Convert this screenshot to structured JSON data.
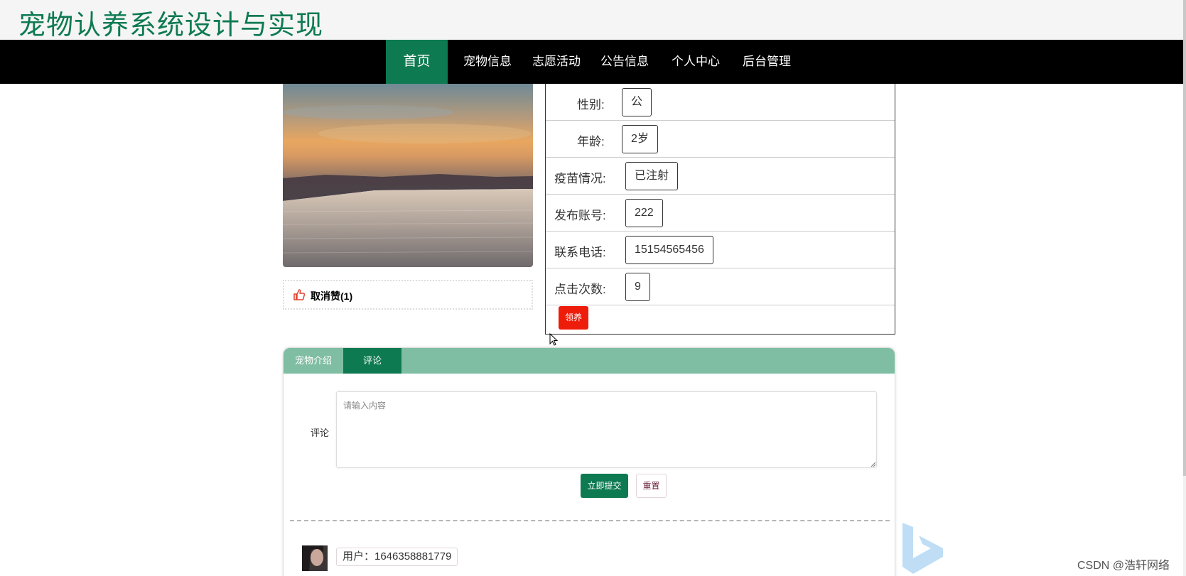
{
  "header": {
    "site_title": "宠物认养系统设计与实现"
  },
  "nav": {
    "items": [
      {
        "label": "首页",
        "active": true
      },
      {
        "label": "宠物信息"
      },
      {
        "label": "志愿活动"
      },
      {
        "label": "公告信息"
      },
      {
        "label": "个人中心"
      },
      {
        "label": "后台管理"
      }
    ]
  },
  "pet": {
    "like_label": "取消赞(1)",
    "fields": [
      {
        "label": "性别:",
        "value": "公"
      },
      {
        "label": "年龄:",
        "value": "2岁"
      },
      {
        "label": "疫苗情况:",
        "value": "已注射"
      },
      {
        "label": "发布账号:",
        "value": "222"
      },
      {
        "label": "联系电话:",
        "value": "15154565456"
      },
      {
        "label": "点击次数:",
        "value": "9"
      }
    ],
    "adopt_label": "领养"
  },
  "tabs": [
    {
      "label": "宠物介绍",
      "active": false
    },
    {
      "label": "评论",
      "active": true
    }
  ],
  "comment": {
    "label": "评论",
    "placeholder": "请输入内容",
    "value": "",
    "submit_label": "立即提交",
    "reset_label": "重置",
    "first_user": "用户：1646358881779"
  },
  "watermark": "CSDN @浩轩网络",
  "colors": {
    "primary": "#0e7a52",
    "tab_bar": "#80bea4",
    "adopt": "#ee1c0a",
    "title": "#0e7a52"
  }
}
